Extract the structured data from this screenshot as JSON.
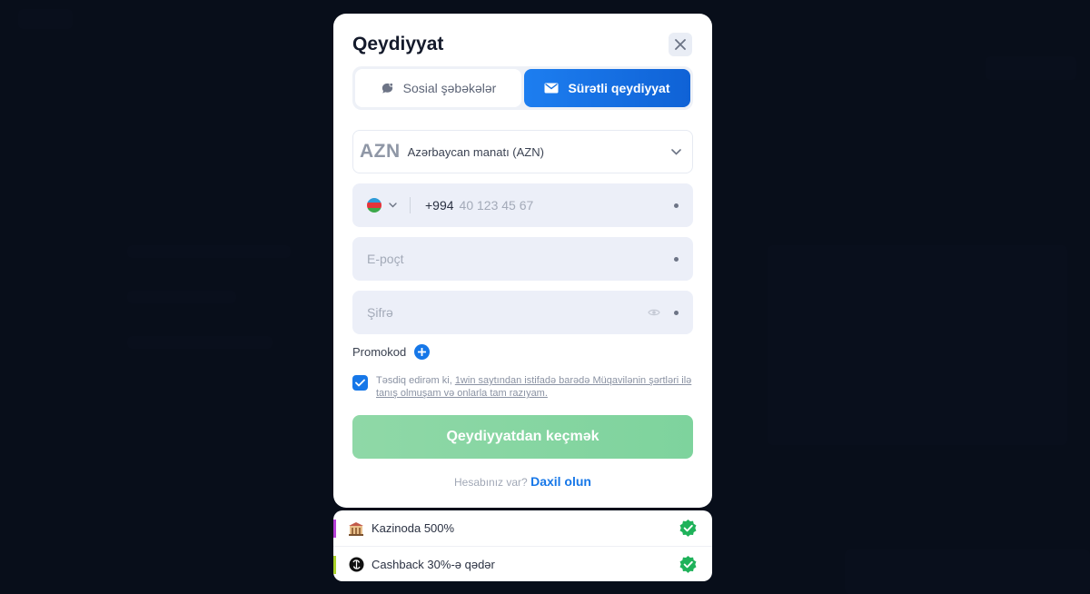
{
  "modal": {
    "title": "Qeydiyyat",
    "tabs": [
      {
        "label": "Sosial şəbəkələr",
        "icon": "chat-bubble-icon",
        "active": false
      },
      {
        "label": "Sürətli qeydiyyat",
        "icon": "envelope-icon",
        "active": true
      }
    ],
    "currency": {
      "code": "AZN",
      "name": "Azərbaycan manatı (AZN)"
    },
    "phone": {
      "dial_code": "+994",
      "placeholder": "40 123 45 67",
      "flag": "azerbaijan-flag"
    },
    "email": {
      "placeholder": "E-poçt"
    },
    "password": {
      "placeholder": "Şifrə"
    },
    "promo_label": "Promokod",
    "agreement": {
      "checked": true,
      "prefix": "Təsdiq edirəm ki, ",
      "link_text": "1win saytından istifadə barədə Müqavilənin şərtləri ilə tanış olmuşam və onlarla tam razıyam."
    },
    "submit_label": "Qeydiyyatdan keçmək",
    "login_prompt": "Hesabınız var?",
    "login_link": "Daxil olun"
  },
  "bonuses": [
    {
      "label": "Kazinoda 500%",
      "icon": "casino-building-icon",
      "strip_color": "#b53fd6"
    },
    {
      "label": "Cashback 30%-ə qədər",
      "icon": "cashback-coin-icon",
      "strip_color": "#a9d12a"
    }
  ],
  "colors": {
    "accent": "#1677e8",
    "submit": "#8fd8a7",
    "check_badge": "#1fb25a"
  }
}
